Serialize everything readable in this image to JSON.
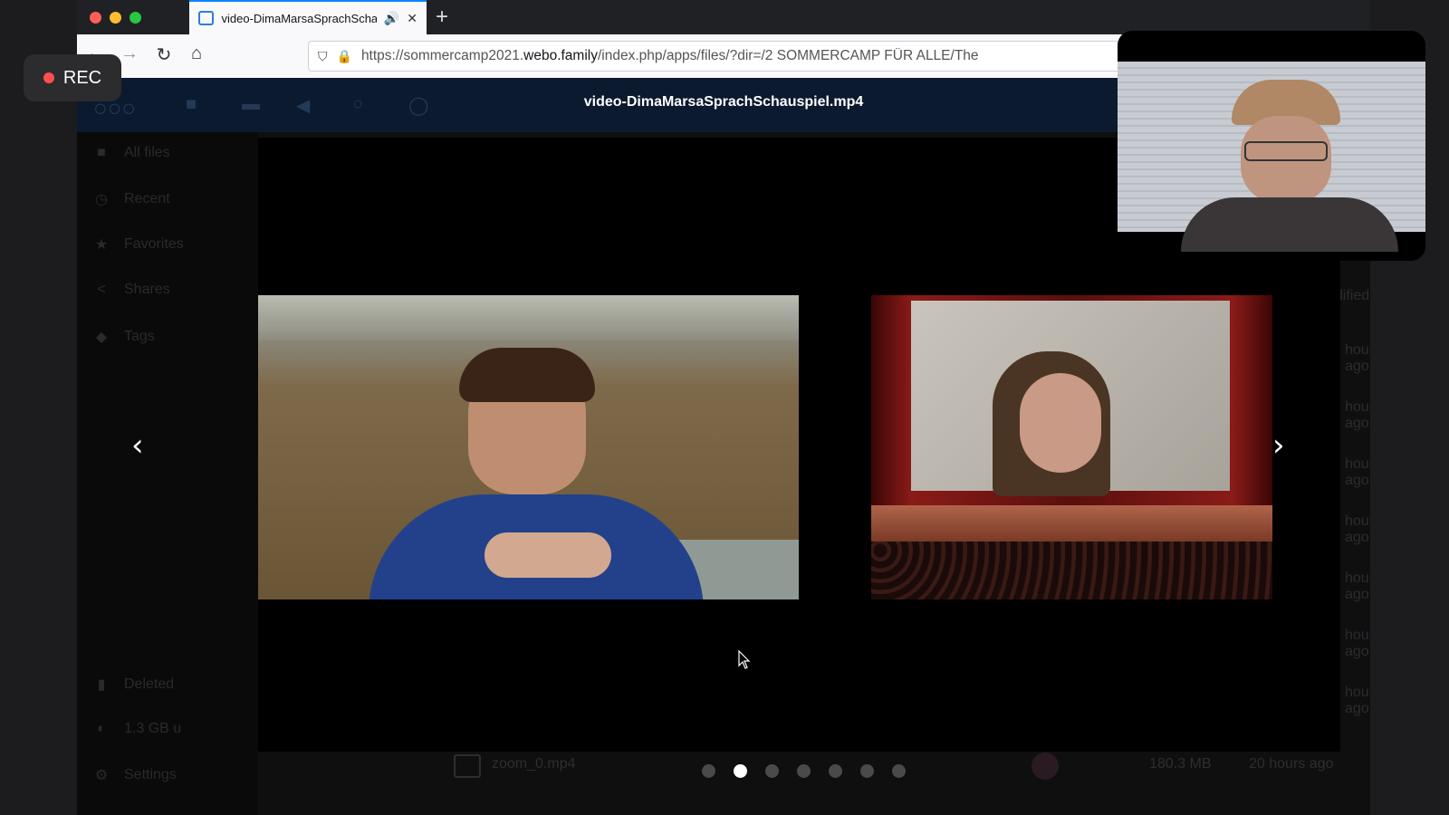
{
  "rec": {
    "label": "REC"
  },
  "browser": {
    "tab_title": "video-DimaMarsaSprachSchauspiel.mp4",
    "url_prefix": "https://sommercamp2021.",
    "url_domain": "webo.family",
    "url_suffix": "/index.php/apps/files/?dir=/2 SOMMERCAMP FÜR ALLE/The"
  },
  "viewer": {
    "title": "video-DimaMarsaSprachSchauspiel.mp4",
    "slide_count": 7,
    "active_slide": 1
  },
  "sidebar": {
    "items": [
      {
        "label": "All files",
        "icon": "folder-icon"
      },
      {
        "label": "Recent",
        "icon": "clock-icon"
      },
      {
        "label": "Favorites",
        "icon": "star-icon"
      },
      {
        "label": "Shares",
        "icon": "share-icon"
      },
      {
        "label": "Tags",
        "icon": "tag-icon"
      }
    ],
    "deleted": "Deleted",
    "quota": "1.3 GB u",
    "settings": "Settings"
  },
  "files": {
    "modified_header": "odified",
    "times": [
      "hours ago",
      "hours ago",
      "hours ago",
      "hours ago",
      "hours ago",
      "hours ago",
      "hours ago"
    ],
    "last_row": {
      "name": "zoom_0.mp4",
      "size": "180.3 MB",
      "time": "20 hours ago"
    }
  }
}
